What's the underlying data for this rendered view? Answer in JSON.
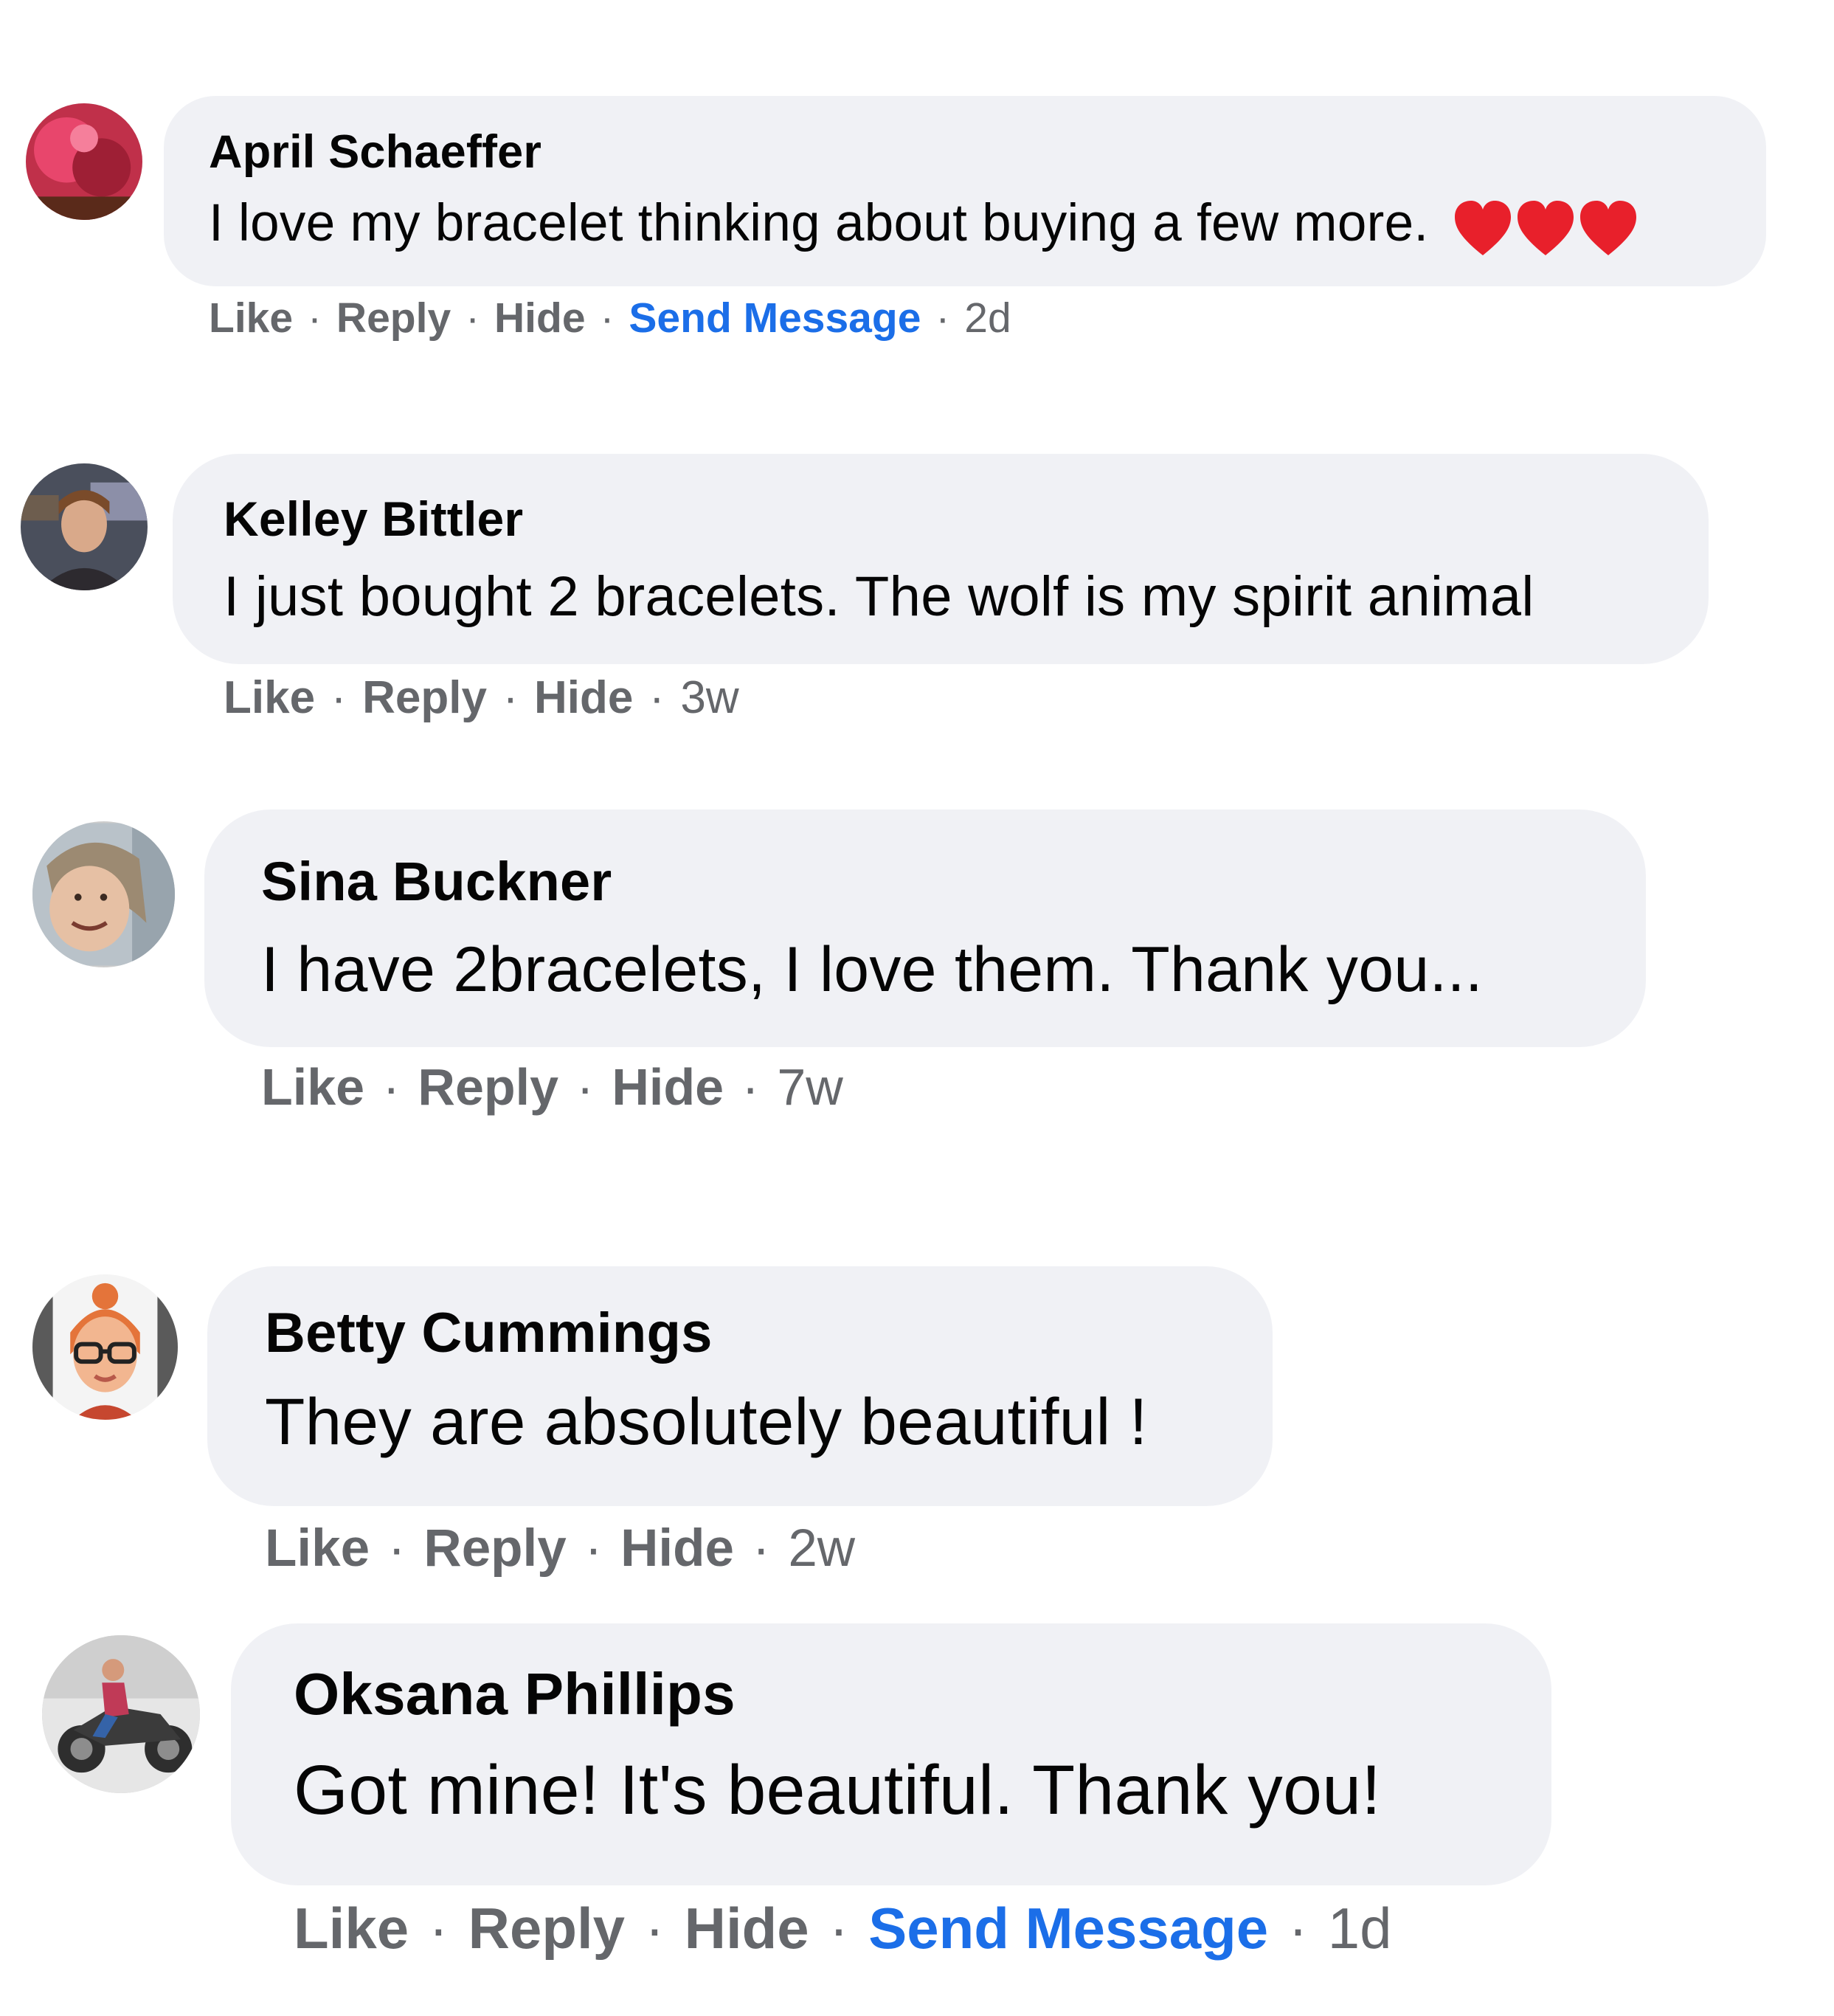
{
  "comments": [
    {
      "author": "April Schaeffer",
      "text": "I love my bracelet thinking about buying a few more.",
      "emoji": "❤❤❤",
      "actions": {
        "like": "Like",
        "reply": "Reply",
        "hide": "Hide",
        "send_message": "Send Message",
        "time": "2d"
      },
      "avatar_icon": "profile-photo-icon"
    },
    {
      "author": "Kelley Bittler",
      "text": "I just bought 2 bracelets. The wolf is my spirit animal",
      "actions": {
        "like": "Like",
        "reply": "Reply",
        "hide": "Hide",
        "time": "3w"
      },
      "avatar_icon": "profile-photo-icon"
    },
    {
      "author": "Sina Buckner",
      "text": "I have 2bracelets, I love them. Thank you...",
      "actions": {
        "like": "Like",
        "reply": "Reply",
        "hide": "Hide",
        "time": "7w"
      },
      "avatar_icon": "profile-photo-icon"
    },
    {
      "author": "Betty Cummings",
      "text": "They are absolutely beautiful !",
      "actions": {
        "like": "Like",
        "reply": "Reply",
        "hide": "Hide",
        "time": "2w"
      },
      "avatar_icon": "memoji-avatar-icon"
    },
    {
      "author": "Oksana Phillips",
      "text": "Got mine! It's beautiful. Thank you!",
      "actions": {
        "like": "Like",
        "reply": "Reply",
        "hide": "Hide",
        "send_message": "Send Message",
        "time": "1d"
      },
      "avatar_icon": "profile-photo-icon"
    }
  ],
  "separator": "·",
  "colors": {
    "bubble": "#f0f1f5",
    "action_text": "#65676b",
    "send_message": "#1b6ee8",
    "heart": "#e8202b"
  }
}
